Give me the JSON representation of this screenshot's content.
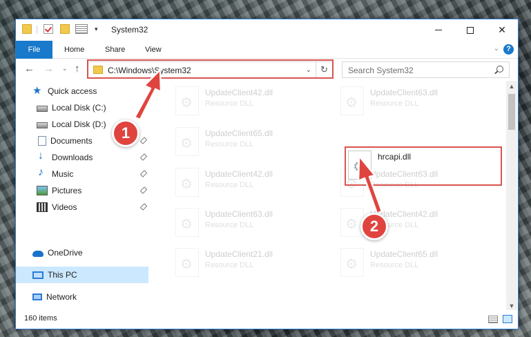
{
  "window": {
    "title": "System32",
    "controls": {
      "minimize": "—",
      "maximize": "☐",
      "close": "✕"
    }
  },
  "ribbon": {
    "tabs": [
      "File",
      "Home",
      "Share",
      "View"
    ],
    "help": "?"
  },
  "navigation": {
    "address": "C:\\Windows\\System32",
    "refresh_glyph": "↻",
    "search_placeholder": "Search System32"
  },
  "sidebar": {
    "items": [
      {
        "label": "Quick access",
        "icon": "star-icon"
      },
      {
        "label": "Local Disk (C:)",
        "icon": "drive-icon"
      },
      {
        "label": "Local Disk (D:)",
        "icon": "drive-icon"
      },
      {
        "label": "Documents",
        "icon": "documents-icon"
      },
      {
        "label": "Downloads",
        "icon": "downloads-icon"
      },
      {
        "label": "Music",
        "icon": "music-icon"
      },
      {
        "label": "Pictures",
        "icon": "pictures-icon"
      },
      {
        "label": "Videos",
        "icon": "videos-icon"
      },
      {
        "label": "OneDrive",
        "icon": "onedrive-icon"
      },
      {
        "label": "This PC",
        "icon": "this-pc-icon",
        "selected": true
      },
      {
        "label": "Network",
        "icon": "network-icon"
      }
    ]
  },
  "files": [
    {
      "name": "UpdateClient42.dll",
      "type": "Resource DLL"
    },
    {
      "name": "UpdateClient63.dll",
      "type": "Resource DLL"
    },
    {
      "name": "UpdateClient65.dll",
      "type": "Resource DLL"
    },
    {
      "name": "hrcapi.dll",
      "type": "",
      "highlighted": true
    },
    {
      "name": "UpdateClient42.dll",
      "type": "Resource DLL"
    },
    {
      "name": "UpdateClient63.dll",
      "type": "Resource DLL"
    },
    {
      "name": "UpdateClient63.dll",
      "type": "Resource DLL"
    },
    {
      "name": "UpdateClient42.dll",
      "type": "Resource DLL"
    },
    {
      "name": "UpdateClient21.dll",
      "type": "Resource DLL"
    },
    {
      "name": "UpdateClient65.dll",
      "type": "Resource DLL"
    }
  ],
  "status": {
    "item_count": "160 items"
  },
  "annotations": {
    "step1": "1",
    "step2": "2",
    "color": "#e0443e"
  }
}
